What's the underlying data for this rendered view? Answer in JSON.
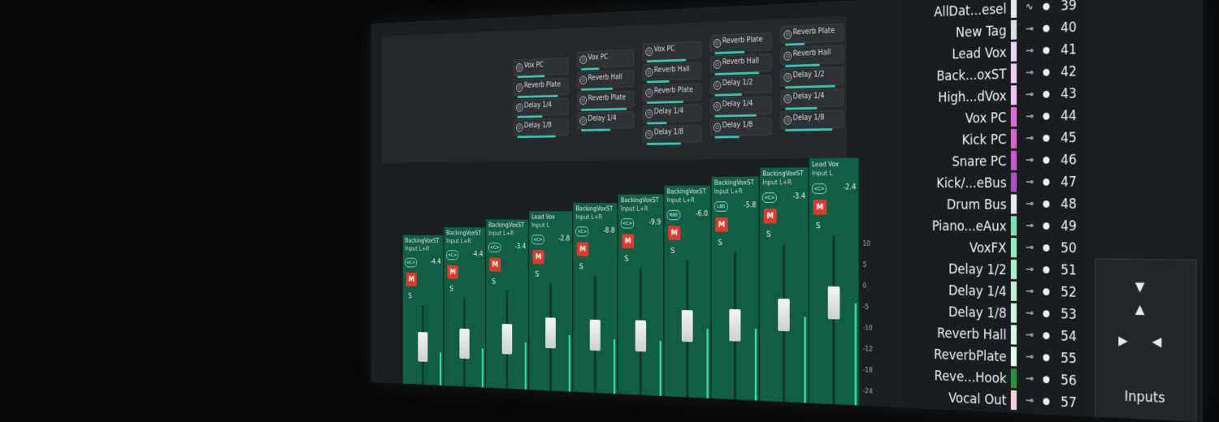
{
  "sends": {
    "columns": [
      {
        "items": [
          "Reverb Plate",
          "Reverb Hall",
          "Delay 1/2",
          "Delay 1/4",
          "Delay 1/8"
        ]
      },
      {
        "items": [
          "Reverb Plate",
          "Reverb Hall",
          "Delay 1/2",
          "Delay 1/4",
          "Delay 1/8"
        ]
      },
      {
        "items": [
          "Vox PC",
          "Reverb Hall",
          "Reverb Plate",
          "Delay 1/4",
          "Delay 1/8"
        ]
      },
      {
        "items": [
          "Vox PC",
          "Reverb Hall",
          "Reverb Plate",
          "Delay 1/4"
        ]
      },
      {
        "items": [
          "Vox PC",
          "Reverb Plate",
          "Delay 1/4",
          "Delay 1/8"
        ]
      }
    ],
    "power_glyph": "⏻"
  },
  "strips": [
    {
      "name": "Lead Vox",
      "io": "Input L",
      "volume": "-2.4",
      "pan": "<C>",
      "mute": "M",
      "solo": "S",
      "fader_level": 0.62
    },
    {
      "name": "BackingVoxST",
      "io": "Input L+R",
      "volume": "-3.4",
      "pan": "<C>",
      "mute": "M",
      "solo": "S",
      "fader_level": 0.56
    },
    {
      "name": "BackingVoxST",
      "io": "Input L+R",
      "volume": "-5.8",
      "pan": "L60",
      "mute": "M",
      "solo": "S",
      "fader_level": 0.5
    },
    {
      "name": "BackingVoxST",
      "io": "Input L+R",
      "volume": "-6.0",
      "pan": "R60",
      "mute": "M",
      "solo": "S",
      "fader_level": 0.52
    },
    {
      "name": "BackingVoxST",
      "io": "Input L+R",
      "volume": "-9.9",
      "pan": "<C>",
      "mute": "M",
      "solo": "S",
      "fader_level": 0.45
    },
    {
      "name": "BackingVoxST",
      "io": "Input L+R",
      "volume": "-8.8",
      "pan": "<C>",
      "mute": "M",
      "solo": "S",
      "fader_level": 0.48
    },
    {
      "name": "Lead Vox",
      "io": "Input L",
      "volume": "-2.8",
      "pan": "<C>",
      "mute": "M",
      "solo": "S",
      "fader_level": 0.55
    },
    {
      "name": "BackingVoxST",
      "io": "Input L+R",
      "volume": "-3.4",
      "pan": "<C>",
      "mute": "M",
      "solo": "S",
      "fader_level": 0.5
    },
    {
      "name": "BackingVoxST",
      "io": "Input L+R",
      "volume": "-4.4",
      "pan": "<C>",
      "mute": "M",
      "solo": "S",
      "fader_level": 0.46
    },
    {
      "name": "BackingVoxST",
      "io": "Input L+R",
      "volume": "-4.4",
      "pan": "<C>",
      "mute": "M",
      "solo": "S",
      "fader_level": 0.44
    }
  ],
  "fader_scale": [
    "10",
    "5",
    "0",
    "-5",
    "-10",
    "-12",
    "-18",
    "-24"
  ],
  "tracks": [
    {
      "name": "AllDat...esel",
      "num": "39",
      "color": "#e8e8e8",
      "icon": "∿"
    },
    {
      "name": "New Tag",
      "num": "40",
      "color": "#e0e0e0",
      "icon": "⊸"
    },
    {
      "name": "Lead Vox",
      "num": "41",
      "color": "#e8d7f2",
      "icon": "⊸"
    },
    {
      "name": "Back...oxST",
      "num": "42",
      "color": "#f0d0f0",
      "icon": "⊸"
    },
    {
      "name": "High...dVox",
      "num": "43",
      "color": "#f2c4f2",
      "icon": "⊸"
    },
    {
      "name": "Vox PC",
      "num": "44",
      "color": "#e36cd8",
      "icon": "⊸"
    },
    {
      "name": "Kick PC",
      "num": "45",
      "color": "#d866cf",
      "icon": "⊸"
    },
    {
      "name": "Snare PC",
      "num": "46",
      "color": "#c95ac8",
      "icon": "⊸"
    },
    {
      "name": "Kick/...eBus",
      "num": "47",
      "color": "#b050c2",
      "icon": "⊸"
    },
    {
      "name": "Drum Bus",
      "num": "48",
      "color": "#e8e8f0",
      "icon": "⊸"
    },
    {
      "name": "Piano...eAux",
      "num": "49",
      "color": "#7de3b6",
      "icon": "⊸"
    },
    {
      "name": "VoxFX",
      "num": "50",
      "color": "#97edc6",
      "icon": "⊸"
    },
    {
      "name": "Delay 1/2",
      "num": "51",
      "color": "#a9f0d0",
      "icon": "⊸"
    },
    {
      "name": "Delay 1/4",
      "num": "52",
      "color": "#bdf3d9",
      "icon": "⊸"
    },
    {
      "name": "Delay 1/8",
      "num": "53",
      "color": "#cdf6e2",
      "icon": "⊸"
    },
    {
      "name": "Reverb Hall",
      "num": "54",
      "color": "#d8f8e8",
      "icon": "⊸"
    },
    {
      "name": "ReverbPlate",
      "num": "55",
      "color": "#e4fbee",
      "icon": "⊸"
    },
    {
      "name": "Reve...Hook",
      "num": "56",
      "color": "#2f8f3f",
      "icon": "⊸"
    },
    {
      "name": "Vocal Out",
      "num": "57",
      "color": "#f4d2d6",
      "icon": "⊸"
    }
  ],
  "inputs_panel": {
    "label": "Inputs",
    "up": "▲",
    "down": "▼",
    "left": "◀",
    "right": "▶"
  }
}
